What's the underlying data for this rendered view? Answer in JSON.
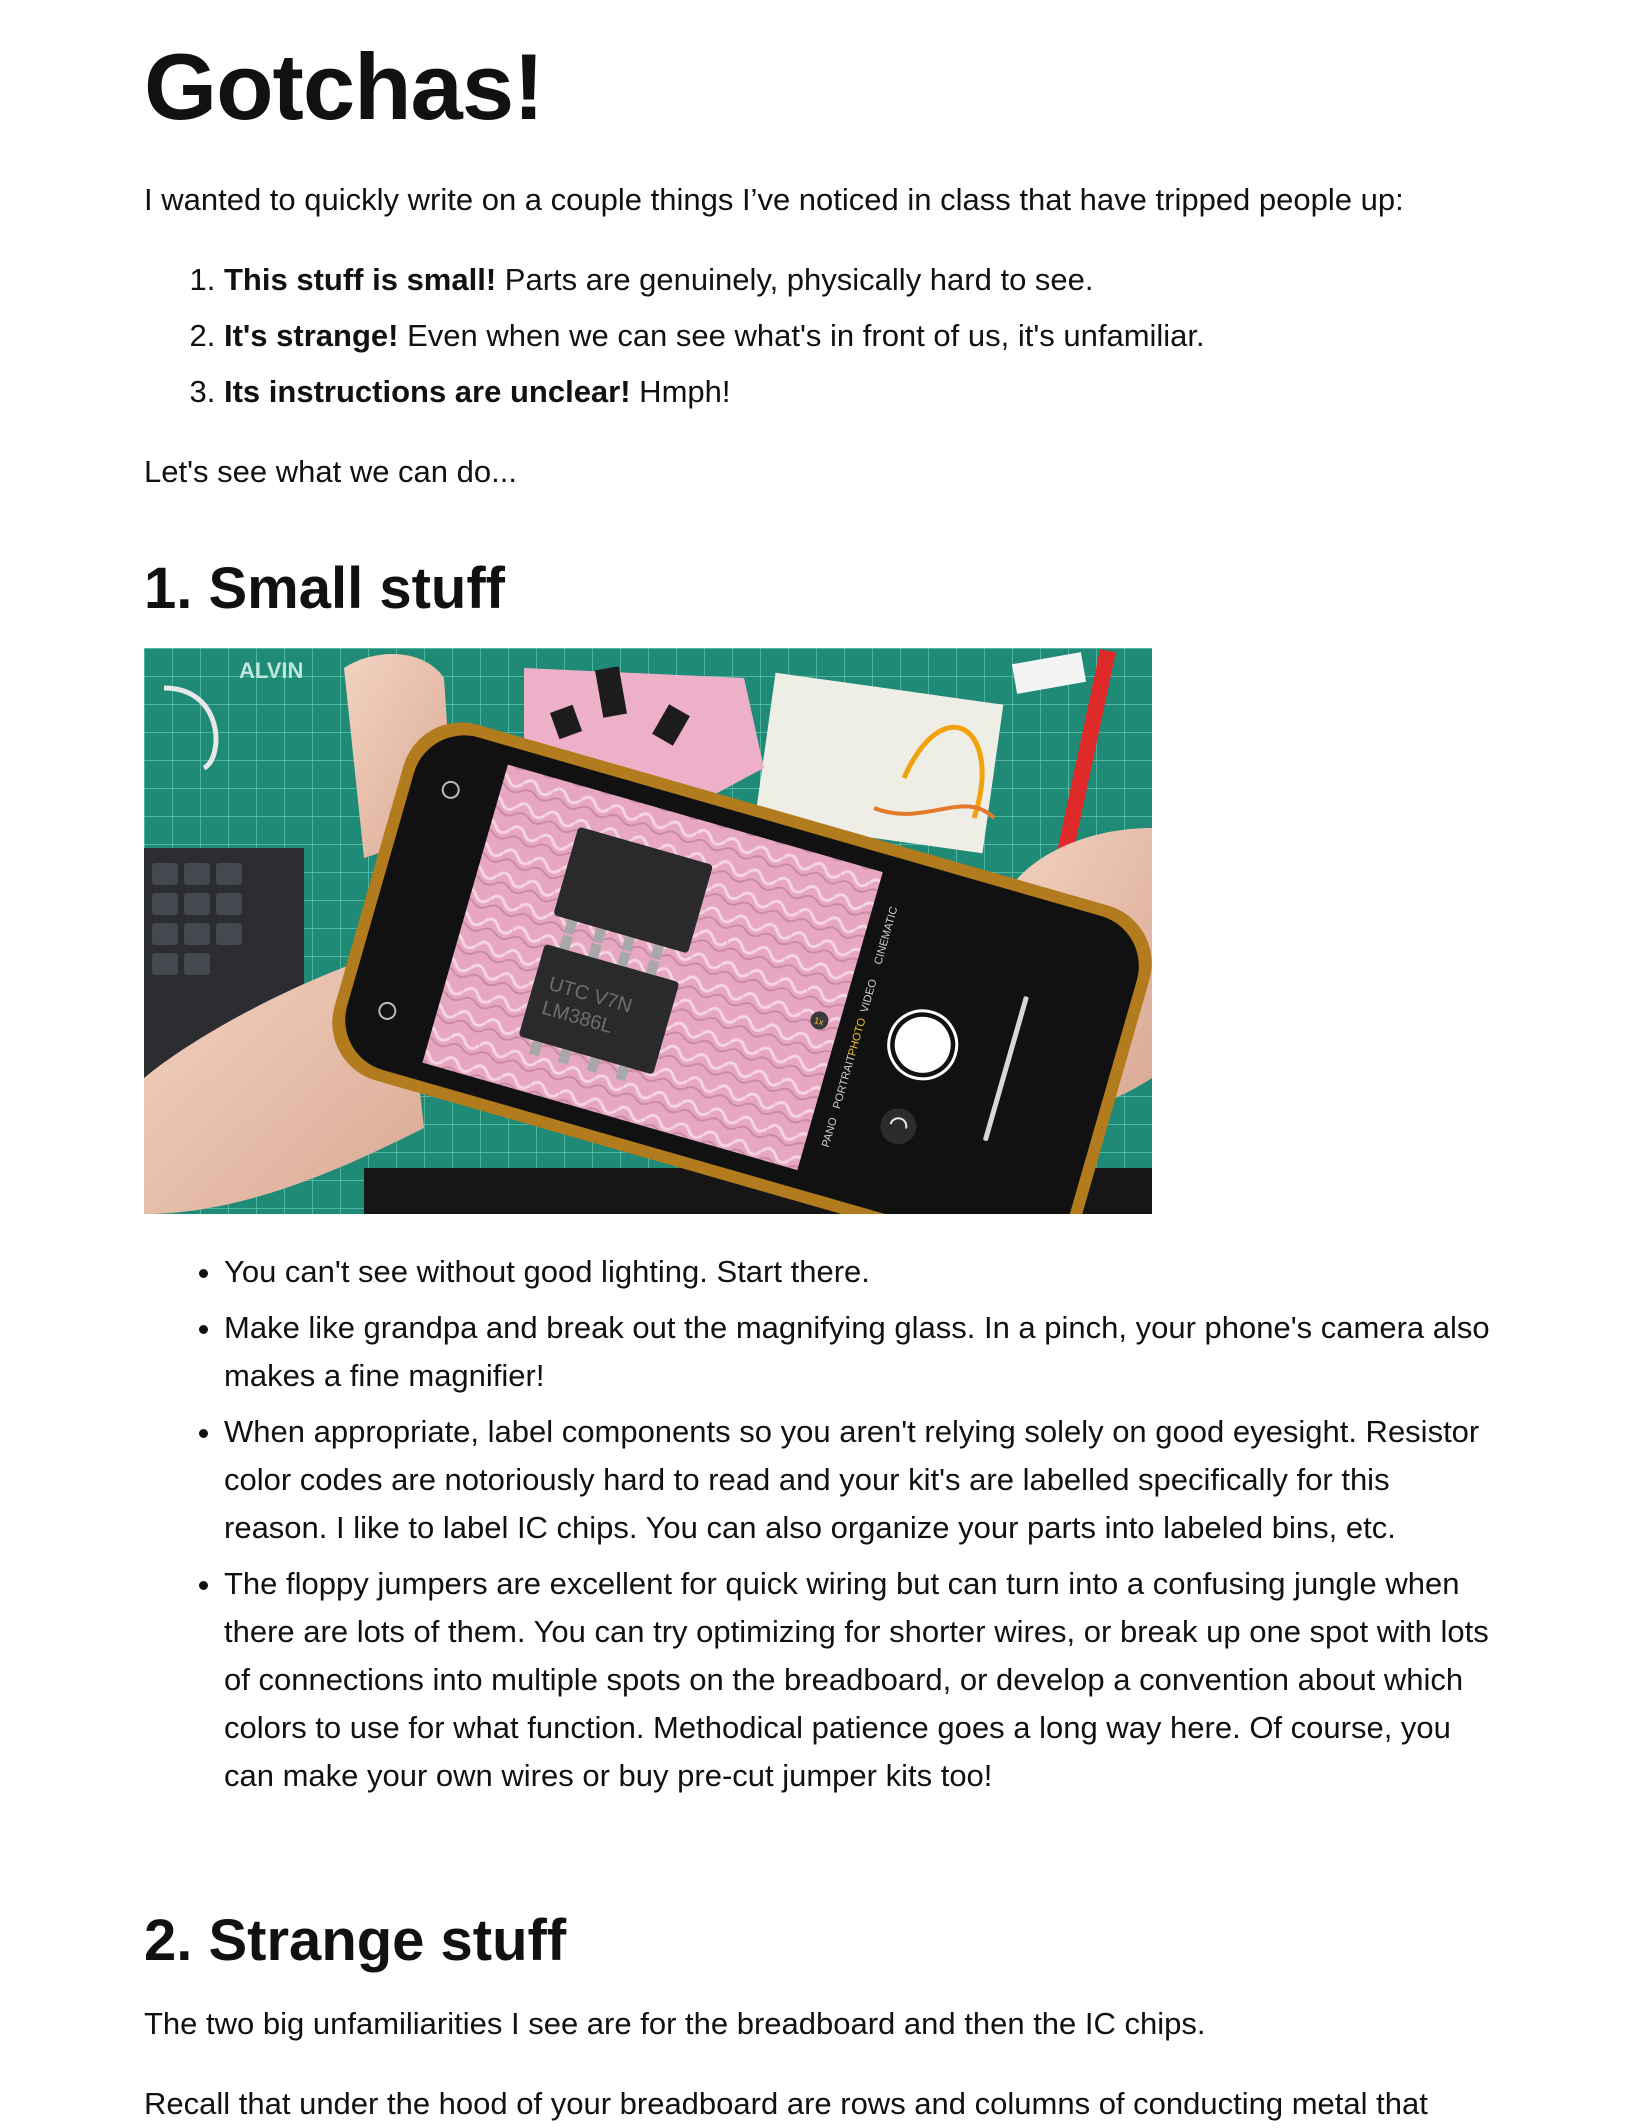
{
  "title": "Gotchas!",
  "intro": "I wanted to quickly write on a couple things I’ve noticed in class that have tripped people up:",
  "gotchas": [
    {
      "bold": "This stuff is small!",
      "rest": " Parts are genuinely, physically hard to see."
    },
    {
      "bold": "It's strange!",
      "rest": " Even when we can see what's in front of us, it's unfamiliar."
    },
    {
      "bold": "Its instructions are unclear!",
      "rest": " Hmph!"
    }
  ],
  "lets_see": "Let's see what we can do...",
  "section1": {
    "heading": "1. Small stuff",
    "photo": {
      "mat_brand": "ALVIN",
      "chip_text_1": "UTC V7N",
      "chip_text_2": "LM386L",
      "camera_modes": [
        "CINEMATIC",
        "VIDEO",
        "PHOTO",
        "PORTRAIT",
        "PANO"
      ],
      "zoom_label": "1x"
    },
    "tips": [
      "You can't see without good lighting. Start there.",
      "Make like grandpa and break out the magnifying glass. In a pinch, your phone's camera also makes a fine magnifier!",
      "When appropriate, label components so you aren't relying solely on good eyesight. Resistor color codes are notoriously hard to read and your kit's are labelled specifically for this reason. I like to label IC chips. You can also organize your parts into labeled bins, etc.",
      "The floppy jumpers are excellent for quick wiring but can turn into a confusing jungle when there are lots of them. You can try optimizing for shorter wires, or break up one spot with lots of connections into multiple spots on the breadboard, or develop a convention about which colors to use for what function. Methodical patience goes a long way here. Of course, you can make your own wires or buy pre-cut jumper kits too!"
    ]
  },
  "section2": {
    "heading": "2. Strange stuff",
    "p1": "The two big unfamiliarities I see are for the breadboard and then the IC chips.",
    "p2": "Recall that under the hood of your breadboard are rows and columns of conducting metal that"
  }
}
